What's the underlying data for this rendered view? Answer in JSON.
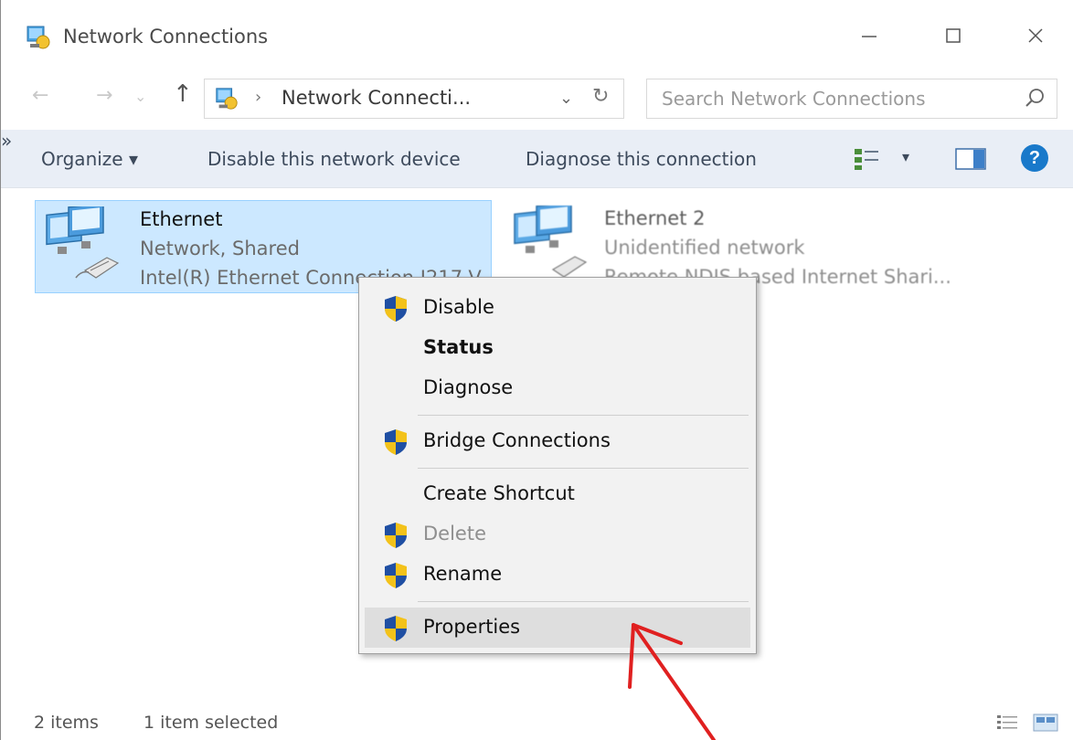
{
  "window": {
    "title": "Network Connections",
    "icons": {
      "app": "network-connections-icon",
      "minimize": "minimize-icon",
      "maximize": "maximize-icon",
      "close": "close-icon"
    }
  },
  "address": {
    "back_glyph": "←",
    "forward_glyph": "→",
    "recent_glyph": "⌄",
    "up_glyph": "↑",
    "separator": "›",
    "path": "Network Connecti...",
    "dropdown_glyph": "⌄",
    "refresh_glyph": "↻"
  },
  "search": {
    "placeholder": "Search Network Connections"
  },
  "commandbar": {
    "organize": "Organize ▾",
    "disable_device": "Disable this network device",
    "diagnose": "Diagnose this connection",
    "more": "»",
    "view_dropdown": "▾",
    "help": "?"
  },
  "items": [
    {
      "name": "Ethernet",
      "status": "Network, Shared",
      "device": "Intel(R) Ethernet Connection I217-V",
      "selected": true
    },
    {
      "name": "Ethernet 2",
      "status": "Unidentified network",
      "device": "Remote NDIS based Internet Shari...",
      "selected": false
    }
  ],
  "context_menu": {
    "items": [
      {
        "label": "Disable",
        "shield": true
      },
      {
        "label": "Status",
        "bold": true
      },
      {
        "label": "Diagnose"
      },
      {
        "label": "Bridge Connections",
        "shield": true
      },
      {
        "label": "Create Shortcut"
      },
      {
        "label": "Delete",
        "shield": true,
        "disabled": true
      },
      {
        "label": "Rename",
        "shield": true
      },
      {
        "label": "Properties",
        "shield": true,
        "hover": true
      }
    ]
  },
  "statusbar": {
    "count": "2 items",
    "selected": "1 item selected"
  },
  "colors": {
    "selection_bg": "#cce8ff",
    "selection_border": "#99d1ff",
    "commandbar_bg": "#e9eef6",
    "menu_bg": "#f2f2f2",
    "menu_hover": "#dedede",
    "help": "#1979ca",
    "annotation_arrow": "#e02020"
  }
}
